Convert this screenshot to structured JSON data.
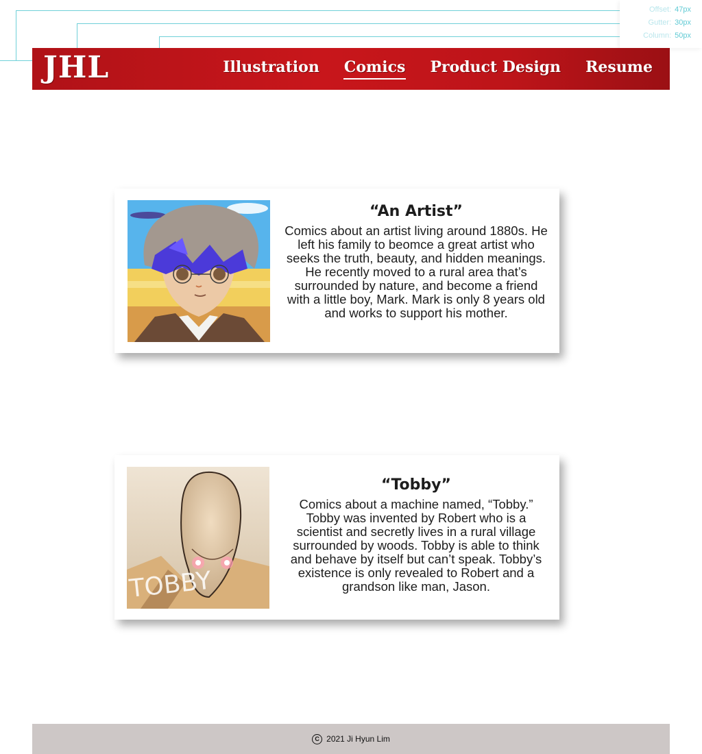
{
  "grid_legend": {
    "offset": {
      "label": "Offset:",
      "value": "47px"
    },
    "gutter": {
      "label": "Gutter:",
      "value": "30px"
    },
    "column": {
      "label": "Column:",
      "value": "50px"
    }
  },
  "header": {
    "logo": "JHL",
    "nav": [
      {
        "label": "Illustration",
        "active": false
      },
      {
        "label": "Comics",
        "active": true
      },
      {
        "label": "Product Design",
        "active": false
      },
      {
        "label": "Resume",
        "active": false
      }
    ]
  },
  "comics": [
    {
      "title": "“An Artist”",
      "description": "Comics about an artist living around 1880s. He left his family to beomce a great artist who seeks the truth, beauty, and hidden meanings. He recently moved to a rural area that’s surrounded by nature, and become a friend with a little boy, Mark. Mark is only 8 years old and works to support his mother."
    },
    {
      "title": "“Tobby”",
      "description": "Comics about a machine named, “Tobby.” Tobby was invented by Robert who is a scientist and secretly lives in a rural village surrounded by woods. Tobby is able to think and behave by itself but can’t speak. Tobby’s existence is only revealed to Robert and a grandson like man, Jason.",
      "cover_text": "TOBBY"
    }
  ],
  "footer": {
    "icon": "copyright-icon",
    "text": "2021 Ji Hyun Lim"
  },
  "colors": {
    "header_red": "#c8161b",
    "guide_cyan": "#5fcad4",
    "footer_gray": "#cdc7c6"
  }
}
